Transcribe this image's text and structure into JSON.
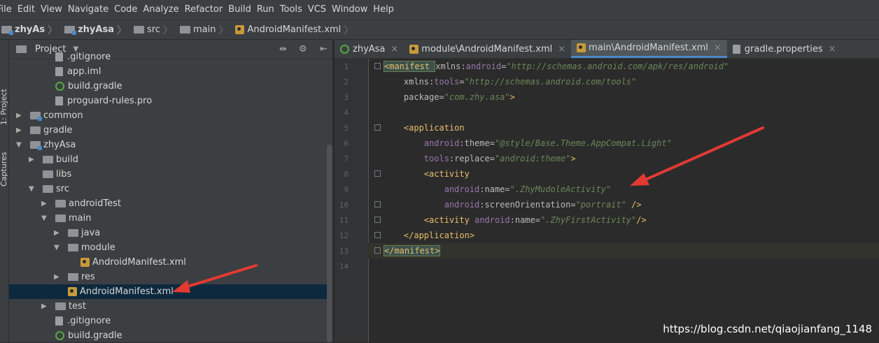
{
  "menu": [
    "File",
    "Edit",
    "View",
    "Navigate",
    "Code",
    "Analyze",
    "Refactor",
    "Build",
    "Run",
    "Tools",
    "VCS",
    "Window",
    "Help"
  ],
  "breadcrumbs": [
    "zhyAs",
    "zhyAsa",
    "src",
    "main",
    "AndroidManifest.xml"
  ],
  "sidebar_tabs": {
    "project": "1: Project",
    "captures": "Captures"
  },
  "project_panel": {
    "title": "Project"
  },
  "tree": [
    {
      "label": ".gitignore",
      "icon": "file",
      "indent": 3,
      "arrow": ""
    },
    {
      "label": "app.iml",
      "icon": "file",
      "indent": 3,
      "arrow": ""
    },
    {
      "label": "build.gradle",
      "icon": "gradle",
      "indent": 3,
      "arrow": ""
    },
    {
      "label": "proguard-rules.pro",
      "icon": "file",
      "indent": 3,
      "arrow": ""
    },
    {
      "label": "common",
      "icon": "module",
      "indent": 1,
      "arrow": "▶"
    },
    {
      "label": "gradle",
      "icon": "folder",
      "indent": 1,
      "arrow": "▶"
    },
    {
      "label": "zhyAsa",
      "icon": "module",
      "indent": 1,
      "arrow": "▼"
    },
    {
      "label": "build",
      "icon": "folder",
      "indent": 2,
      "arrow": "▶"
    },
    {
      "label": "libs",
      "icon": "folder",
      "indent": 2,
      "arrow": ""
    },
    {
      "label": "src",
      "icon": "folder",
      "indent": 2,
      "arrow": "▼"
    },
    {
      "label": "androidTest",
      "icon": "folder",
      "indent": 3,
      "arrow": "▶"
    },
    {
      "label": "main",
      "icon": "folder",
      "indent": 3,
      "arrow": "▼"
    },
    {
      "label": "java",
      "icon": "folder",
      "indent": 4,
      "arrow": "▶"
    },
    {
      "label": "module",
      "icon": "folder",
      "indent": 4,
      "arrow": "▼"
    },
    {
      "label": "AndroidManifest.xml",
      "icon": "xml",
      "indent": 5,
      "arrow": ""
    },
    {
      "label": "res",
      "icon": "folder",
      "indent": 4,
      "arrow": "▶"
    },
    {
      "label": "AndroidManifest.xml",
      "icon": "xml",
      "indent": 4,
      "arrow": "",
      "selected": true
    },
    {
      "label": "test",
      "icon": "folder",
      "indent": 3,
      "arrow": "▶"
    },
    {
      "label": ".gitignore",
      "icon": "file",
      "indent": 3,
      "arrow": ""
    },
    {
      "label": "build.gradle",
      "icon": "gradle",
      "indent": 3,
      "arrow": ""
    }
  ],
  "tabs": [
    {
      "label": "zhyAsa",
      "icon": "gradle",
      "active": false
    },
    {
      "label": "module\\AndroidManifest.xml",
      "icon": "xml",
      "active": false
    },
    {
      "label": "main\\AndroidManifest.xml",
      "icon": "xml",
      "active": true
    },
    {
      "label": "gradle.properties",
      "icon": "file",
      "active": false
    }
  ],
  "line_numbers": [
    "1",
    "2",
    "3",
    "4",
    "5",
    "6",
    "7",
    "8",
    "9",
    "10",
    "11",
    "12",
    "13",
    "14"
  ],
  "code_lines": [
    [
      [
        "t",
        "<manifest "
      ],
      [
        "a",
        "xmlns:"
      ],
      [
        "ns",
        "android"
      ],
      [
        "a",
        "="
      ],
      [
        "v",
        "\"http://schemas.android.com/apk/res/android\""
      ]
    ],
    [
      [
        "a",
        "    xmlns:"
      ],
      [
        "ns",
        "tools"
      ],
      [
        "a",
        "="
      ],
      [
        "v",
        "\"http://schemas.android.com/tools\""
      ]
    ],
    [
      [
        "a",
        "    package="
      ],
      [
        "v",
        "\"com.zhy.asa\""
      ],
      [
        "t",
        ">"
      ]
    ],
    [],
    [
      [
        "t",
        "    <application"
      ]
    ],
    [
      [
        "a",
        "        "
      ],
      [
        "ns",
        "android"
      ],
      [
        "a",
        ":theme="
      ],
      [
        "v",
        "\"@style/Base.Theme.AppCompat.Light\""
      ]
    ],
    [
      [
        "a",
        "        "
      ],
      [
        "ns",
        "tools"
      ],
      [
        "a",
        ":replace="
      ],
      [
        "v",
        "\"android:theme\""
      ],
      [
        "t",
        ">"
      ]
    ],
    [
      [
        "t",
        "        <activity"
      ]
    ],
    [
      [
        "a",
        "            "
      ],
      [
        "ns",
        "android"
      ],
      [
        "a",
        ":name="
      ],
      [
        "v",
        "\".ZhyMudoleActivity\""
      ]
    ],
    [
      [
        "a",
        "            "
      ],
      [
        "ns",
        "android"
      ],
      [
        "a",
        ":screenOrientation="
      ],
      [
        "v",
        "\"portrait\""
      ],
      [
        "t",
        " />"
      ]
    ],
    [
      [
        "t",
        "        <activity "
      ],
      [
        "ns",
        "android"
      ],
      [
        "a",
        ":name="
      ],
      [
        "v",
        "\".ZhyFirstActivity\""
      ],
      [
        "t",
        "/>"
      ]
    ],
    [
      [
        "t",
        "    </application>"
      ]
    ],
    [
      [
        "t",
        "</manifest>"
      ]
    ],
    []
  ],
  "watermark": "https://blog.csdn.net/qiaojianfang_1148",
  "colors": {
    "accent": "#4a88c7",
    "arrow": "#e23a33",
    "selection": "#0d293e"
  }
}
